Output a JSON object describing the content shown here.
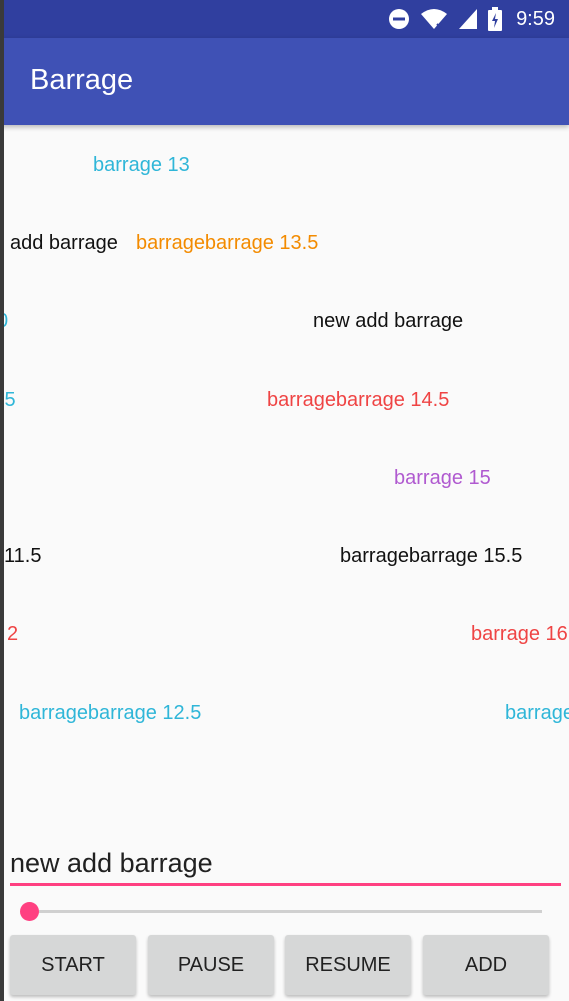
{
  "status_bar": {
    "time": "9:59",
    "icons": [
      "do-not-disturb-icon",
      "wifi-icon",
      "cell-signal-icon",
      "battery-icon"
    ]
  },
  "app_bar": {
    "title": "Barrage"
  },
  "barrages": [
    {
      "text": "barrage 13",
      "color": "#2fb6d8"
    },
    {
      "text": "add barrage",
      "color": "#111111"
    },
    {
      "text": "barragebarrage 13.5",
      "color": "#f38b00"
    },
    {
      "text": "0",
      "color": "#2fb6d8"
    },
    {
      "text": "new add barrage",
      "color": "#111111"
    },
    {
      "text": ".5",
      "color": "#2fb6d8"
    },
    {
      "text": "barragebarrage 14.5",
      "color": "#ef4444"
    },
    {
      "text": "barrage 15",
      "color": "#b05ad0"
    },
    {
      "text": "11.5",
      "color": "#111111"
    },
    {
      "text": "barragebarrage 15.5",
      "color": "#111111"
    },
    {
      "text": "2",
      "color": "#ef4444"
    },
    {
      "text": "barrage 16",
      "color": "#ef4444"
    },
    {
      "text": "barragebarrage 12.5",
      "color": "#2fb6d8"
    },
    {
      "text": "barrage",
      "color": "#2fb6d8"
    }
  ],
  "input": {
    "value": "new add barrage"
  },
  "seekbar": {
    "progress": 0
  },
  "buttons": {
    "start": "START",
    "pause": "PAUSE",
    "resume": "RESUME",
    "add": "ADD"
  },
  "colors": {
    "primary": "#3f51b5",
    "primary_dark": "#303f9f",
    "accent": "#ff4081"
  }
}
